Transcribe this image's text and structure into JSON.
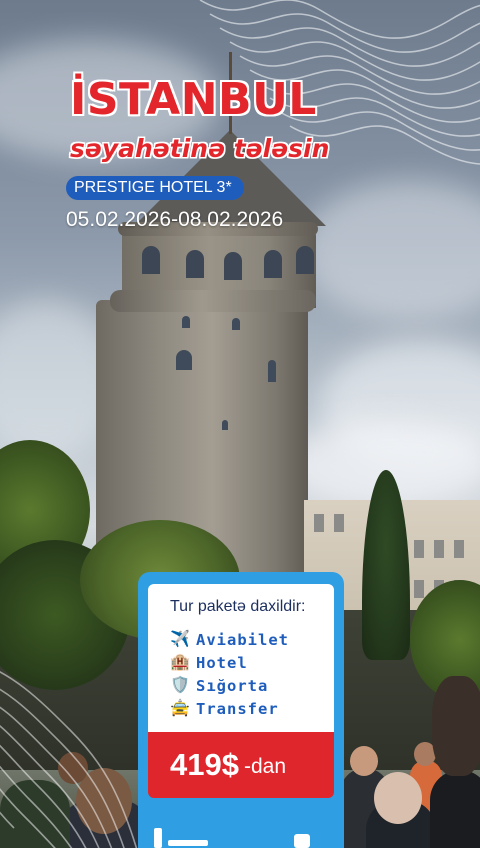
{
  "colors": {
    "accent_red": "#e3262b",
    "brand_blue": "#1f5dbc",
    "card_frame_blue": "#2f9ee3",
    "white": "#ffffff"
  },
  "header": {
    "city": "İSTANBUL",
    "tagline": "səyahətinə tələsin",
    "hotel": "PRESTIGE HOTEL 3*",
    "dates": "05.02.2026-08.02.2026"
  },
  "package": {
    "heading": "Tur paketə daxildir:",
    "items": [
      {
        "icon": "airplane-icon",
        "glyph": "✈️",
        "label": "Aviabilet"
      },
      {
        "icon": "hotel-icon",
        "glyph": "🏨",
        "label": "Hotel"
      },
      {
        "icon": "shield-icon",
        "glyph": "🛡️",
        "label": "Sığorta"
      },
      {
        "icon": "taxi-icon",
        "glyph": "🚖",
        "label": "Transfer"
      }
    ],
    "price": "419$",
    "price_suffix": "-dan"
  }
}
